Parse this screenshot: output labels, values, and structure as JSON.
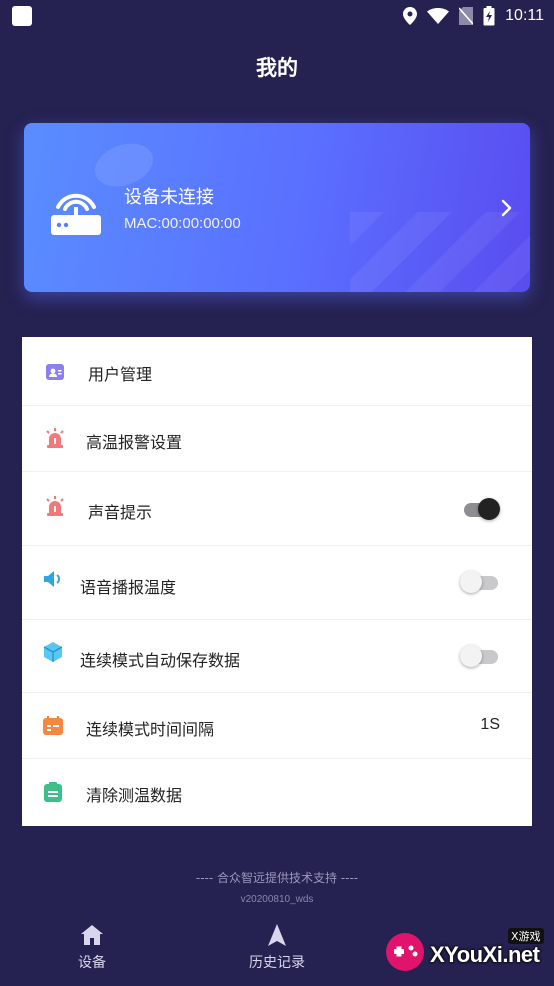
{
  "status_bar": {
    "time": "10:11",
    "icons": [
      "app-square-icon",
      "location-icon",
      "wifi-icon",
      "no-sim-icon",
      "battery-charging-icon"
    ]
  },
  "header": {
    "title": "我的"
  },
  "device_card": {
    "status": "设备未连接",
    "mac": "MAC:00:00:00:00",
    "icon": "router-icon",
    "accent_start": "#5a8dff",
    "accent_end": "#5a4cf0"
  },
  "menu": {
    "user_management": {
      "label": "用户管理",
      "icon": "user-card-icon"
    },
    "high_temp_alarm": {
      "label": "高温报警设置",
      "icon": "alarm-light-icon"
    },
    "sound_prompt": {
      "label": "声音提示",
      "icon": "alarm-light-icon",
      "toggle_on": true
    },
    "voice_broadcast": {
      "label": "语音播报温度",
      "icon": "speaker-icon",
      "toggle_on": false
    },
    "auto_save": {
      "label": "连续模式自动保存数据",
      "icon": "cube-icon",
      "toggle_on": false
    },
    "interval": {
      "label": "连续模式时间间隔",
      "icon": "calendar-icon",
      "value": "1S"
    },
    "clear_data": {
      "label": "清除测温数据",
      "icon": "clipboard-icon"
    }
  },
  "footer": {
    "support": "----    合众智远提供技术支持    ----",
    "version": "v20200810_wds"
  },
  "bottom_nav": {
    "device": {
      "label": "设备",
      "icon": "home-icon"
    },
    "history": {
      "label": "历史记录",
      "icon": "navigation-arrow-icon"
    }
  },
  "watermark": {
    "text": "XYouXi.net",
    "small": "X游戏"
  },
  "colors": {
    "background": "#252150",
    "panel": "#ffffff",
    "toggle_on": "#222222"
  }
}
